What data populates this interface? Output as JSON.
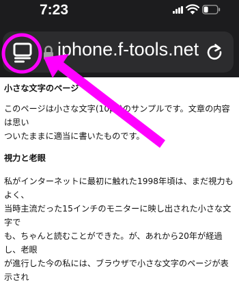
{
  "status_bar": {
    "time": "7:23"
  },
  "address_bar": {
    "url": "iphone.f-tools.net",
    "tab_overview_icon": "tab-overview-icon",
    "lock_icon": "lock-icon",
    "reload_icon": "reload-icon"
  },
  "page": {
    "heading1": "小さな文字のページ",
    "para1_line1": "このページは小さな文字(10px)のサンプルです。文章の内容は思い",
    "para1_line2": "ついたままに適当に書いたものです。",
    "heading2": "視力と老眼",
    "para2_line1": "私がインターネットに最初に触れた1998年頃は、まだ視力もよく、",
    "para2_line2": "当時主流だった15インチのモニターに映し出された小さな文字で",
    "para2_line3": "も、ちゃんと読むことができた。が、あれから20年が経過し、老眼",
    "para2_line4": "が進行した今の私には、ブラウザで小さな文字のページが表示され"
  },
  "colors": {
    "chrome_background": "#1c1c1e",
    "url_bar_background": "#2c2c2e",
    "annotation_magenta": "#ff00ff"
  }
}
